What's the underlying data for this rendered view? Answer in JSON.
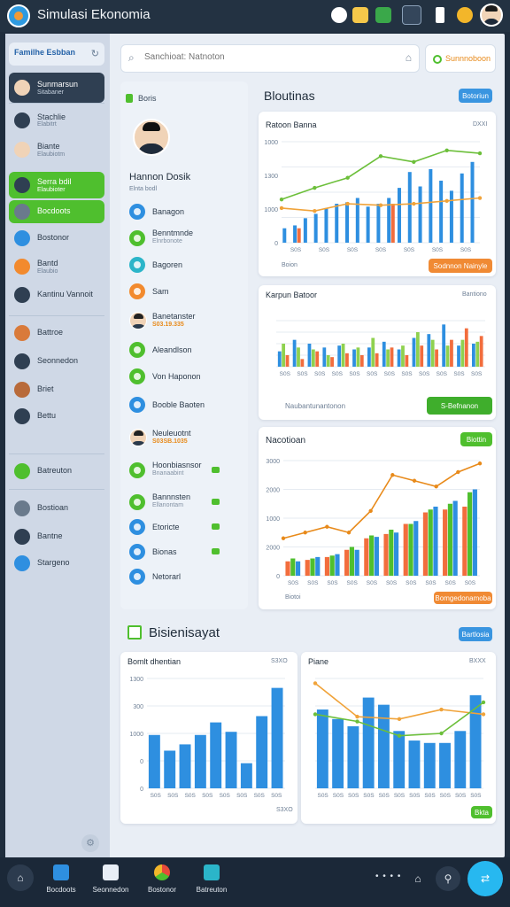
{
  "app": {
    "title": "Simulasi Ekonomia"
  },
  "colors": {
    "blue": "#2e8fe0",
    "green": "#4fbf2e",
    "orange": "#f26d3d",
    "teal": "#2bb5c9",
    "dark": "#2f3f52"
  },
  "sidebar": {
    "header": "Familhe Esbban",
    "items": [
      {
        "label": "Sunmarsun",
        "sub": "Sitabaner",
        "style": "dark",
        "icon": "avatar"
      },
      {
        "label": "Stachlie",
        "sub": "Elabitrt",
        "style": "plain",
        "icon": "clock-icon"
      },
      {
        "label": "Biante",
        "sub": "Elaubiotm",
        "style": "plain",
        "icon": "avatar"
      },
      {
        "label": "Serra bdil",
        "sub": "Elaubioter",
        "style": "green",
        "icon": "globe-icon"
      },
      {
        "label": "Bocdoots",
        "sub": "",
        "style": "green",
        "icon": "gear-icon"
      },
      {
        "label": "Bostonor",
        "sub": "",
        "style": "plain",
        "icon": "document-icon"
      },
      {
        "label": "Bantd",
        "sub": "Elaubio",
        "style": "plain",
        "icon": "coin-icon"
      },
      {
        "label": "Kantinu Vannoit",
        "sub": "",
        "style": "plain",
        "icon": "refresh-icon"
      },
      {
        "label": "Battroe",
        "sub": "",
        "style": "plain",
        "icon": "people-icon"
      },
      {
        "label": "Seonnedon",
        "sub": "",
        "style": "plain",
        "icon": "star-icon"
      },
      {
        "label": "Briet",
        "sub": "",
        "style": "plain",
        "icon": "person-icon"
      },
      {
        "label": "Bettu",
        "sub": "",
        "style": "plain",
        "icon": "bank-icon"
      },
      {
        "label": "Batreuton",
        "sub": "",
        "style": "plain",
        "icon": "chart-icon"
      },
      {
        "label": "Bostioan",
        "sub": "",
        "style": "plain",
        "icon": "leaf-icon"
      },
      {
        "label": "Bantne",
        "sub": "",
        "style": "plain",
        "icon": "people-icon"
      },
      {
        "label": "Stargeno",
        "sub": "",
        "style": "plain",
        "icon": "star-icon"
      }
    ]
  },
  "search": {
    "placeholder": "Sanchioat: Natnoton"
  },
  "status": {
    "label": "Sunnnoboon"
  },
  "contacts": {
    "header": "Boris",
    "profile_name": "Hannon Dosik",
    "profile_sub": "Elnta bodl",
    "rows": [
      {
        "label": "Banagon",
        "sub": "",
        "color": "#2e8fe0"
      },
      {
        "label": "Benntmnde",
        "sub": "Elnrbonote",
        "color": "#4fbf2e"
      },
      {
        "label": "Bagoren",
        "sub": "",
        "color": "#2bb5c9"
      },
      {
        "label": "Sam",
        "sub": "",
        "color": "#f28a2e"
      },
      {
        "label": "Banetanster",
        "sub": "S03.19.335",
        "color": "avatar"
      },
      {
        "label": "Aleandlson",
        "sub": "",
        "color": "#4fbf2e"
      },
      {
        "label": "Von Haponon",
        "sub": "",
        "color": "#4fbf2e"
      },
      {
        "label": "Booble Baoten",
        "sub": "",
        "color": "#2e8fe0"
      },
      {
        "label": "Neuleuotnt",
        "sub": "S03SB.1035",
        "color": "avatar"
      },
      {
        "label": "Hoonbiasnsor",
        "sub": "Bnanaabint",
        "color": "#4fbf2e"
      },
      {
        "label": "Bannnsten",
        "sub": "Ellanontam",
        "color": "#4fbf2e"
      },
      {
        "label": "Etoricte",
        "sub": "",
        "color": "#2e8fe0"
      },
      {
        "label": "Bionas",
        "sub": "",
        "color": "#2e8fe0"
      },
      {
        "label": "Netorarl",
        "sub": "",
        "color": "#2e8fe0"
      }
    ]
  },
  "top_section": {
    "title": "Bloutinas",
    "button": "Botoriun"
  },
  "card1": {
    "title": "Ratoon Banna",
    "meta": "DXXI",
    "footer_meta": "Boion",
    "button": "Sodnnon Nainyle"
  },
  "card2": {
    "title": "Karpun Batoor",
    "meta": "Bantiono",
    "footer": "Naubantunantonon",
    "button": "S-Befnanon"
  },
  "card3": {
    "title": "Nacotioan",
    "button": "Biottin",
    "footer_meta": "Biotoi",
    "footer_button": "Bomgedonamoba"
  },
  "bottom_section": {
    "title": "Bisienisayat",
    "button": "Bartlosia"
  },
  "card4": {
    "title": "Bomlt dhentian",
    "meta": "S3XO",
    "footer_meta": "S3XO"
  },
  "card5": {
    "title": "Piane",
    "meta": "BXXX",
    "button": "Bkta"
  },
  "chart_data": [
    {
      "type": "bar",
      "title": "Ratoon Banna",
      "ytick_labels": [
        "1000",
        "1300",
        "1000",
        "0"
      ],
      "xtick_labels": [
        "S0S",
        "S0S",
        "S0S",
        "S0S",
        "S0S",
        "S0S",
        "S0S"
      ],
      "series": [
        {
          "color": "#2e8fe0",
          "values": [
            10,
            12,
            17,
            20,
            24,
            27,
            28,
            31,
            25,
            27,
            31,
            38,
            49,
            39,
            51,
            43,
            36,
            48,
            56
          ]
        },
        {
          "color": "#f26d3d",
          "values": [
            0,
            10,
            0,
            0,
            0,
            0,
            0,
            0,
            0,
            0,
            27,
            0,
            0,
            0,
            0,
            0,
            0,
            0,
            0
          ]
        }
      ],
      "trend_lines": [
        {
          "color": "#f0a33a",
          "values": [
            24,
            22,
            27,
            26,
            27,
            29,
            31
          ]
        },
        {
          "color": "#6cbf3a",
          "values": [
            30,
            38,
            45,
            60,
            56,
            64,
            62
          ]
        }
      ]
    },
    {
      "type": "bar",
      "title": "Karpun Batoor",
      "xtick_labels": [
        "S0S",
        "S0S",
        "S0S",
        "S0S",
        "S0S",
        "S0S",
        "S0S",
        "S0S",
        "S0S",
        "S0S",
        "S0S",
        "S0S"
      ],
      "series": [
        {
          "color": "#2e8fe0",
          "values": [
            8,
            14,
            12,
            10,
            11,
            9,
            10,
            13,
            9,
            15,
            17,
            22,
            11,
            12
          ]
        },
        {
          "color": "#8fd14f",
          "values": [
            12,
            10,
            9,
            6,
            12,
            10,
            15,
            9,
            11,
            18,
            14,
            11,
            14,
            13
          ]
        },
        {
          "color": "#f26d3d",
          "values": [
            6,
            4,
            8,
            5,
            7,
            6,
            7,
            10,
            6,
            11,
            9,
            14,
            20,
            16
          ]
        }
      ]
    },
    {
      "type": "bar",
      "title": "Nacotioan",
      "ytick_labels": [
        "3000",
        "2000",
        "1000",
        "2000",
        "0"
      ],
      "xtick_labels": [
        "S0S",
        "S0S",
        "S0S",
        "S0S",
        "S0S",
        "S0S",
        "S0S",
        "S0S",
        "S0S",
        "S0S"
      ],
      "series": [
        {
          "color": "#f26d3d",
          "values": [
            10,
            11,
            13,
            18,
            26,
            29,
            36,
            44,
            46,
            48
          ]
        },
        {
          "color": "#4fbf2e",
          "values": [
            12,
            12,
            14,
            20,
            28,
            32,
            36,
            46,
            50,
            58
          ]
        },
        {
          "color": "#2e8fe0",
          "values": [
            10,
            13,
            15,
            18,
            27,
            30,
            38,
            48,
            52,
            60
          ]
        }
      ],
      "trend_lines": [
        {
          "color": "#e88a1a",
          "values": [
            26,
            30,
            34,
            30,
            45,
            70,
            66,
            62,
            72,
            78
          ]
        }
      ]
    },
    {
      "type": "bar",
      "title": "Bomlt dhentian",
      "ytick_labels": [
        "1300",
        "300",
        "1000",
        "0",
        "0"
      ],
      "xtick_labels": [
        "S0S",
        "S0S",
        "S0S",
        "S0S",
        "S0S",
        "S0S",
        "S0S",
        "S0S"
      ],
      "values": [
        34,
        24,
        28,
        34,
        42,
        36,
        16,
        46,
        64
      ]
    },
    {
      "type": "bar",
      "title": "Piane",
      "xtick_labels": [
        "S0S",
        "S0S",
        "S0S",
        "S0S",
        "S0S",
        "S0S",
        "S0S",
        "S0S",
        "S0S",
        "S0S",
        "S0S"
      ],
      "values": [
        66,
        58,
        52,
        76,
        70,
        48,
        40,
        38,
        38,
        48,
        78
      ],
      "trend_lines": [
        {
          "color": "#f0a33a",
          "values": [
            88,
            60,
            58,
            66,
            62
          ]
        },
        {
          "color": "#6cbf3a",
          "values": [
            62,
            56,
            44,
            46,
            72
          ]
        }
      ]
    }
  ]
}
